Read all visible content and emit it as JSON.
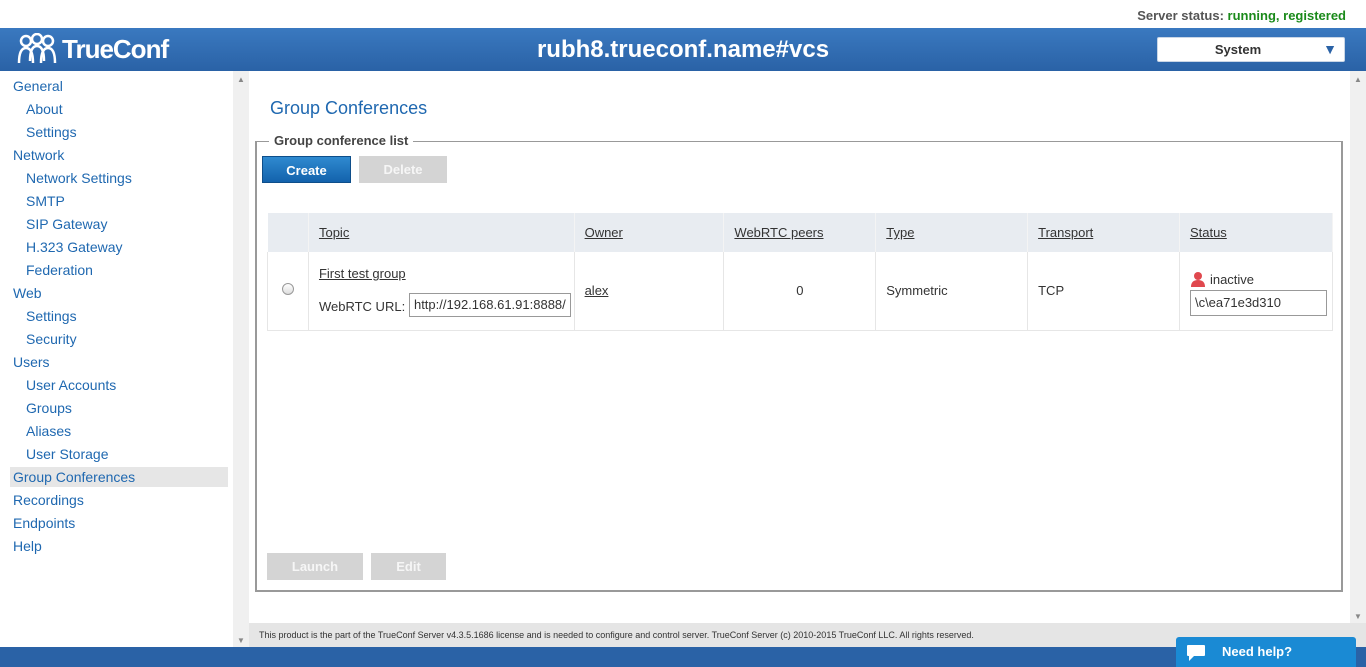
{
  "server_status": {
    "label": "Server status:",
    "value": "running, registered"
  },
  "header": {
    "logo_text": "TrueConf",
    "title": "rubh8.trueconf.name#vcs",
    "select_value": "System"
  },
  "sidebar": {
    "items": [
      {
        "label": "General",
        "level": 0
      },
      {
        "label": "About",
        "level": 1
      },
      {
        "label": "Settings",
        "level": 1
      },
      {
        "label": "Network",
        "level": 0
      },
      {
        "label": "Network Settings",
        "level": 1
      },
      {
        "label": "SMTP",
        "level": 1
      },
      {
        "label": "SIP Gateway",
        "level": 1
      },
      {
        "label": "H.323 Gateway",
        "level": 1
      },
      {
        "label": "Federation",
        "level": 1
      },
      {
        "label": "Web",
        "level": 0
      },
      {
        "label": "Settings",
        "level": 1
      },
      {
        "label": "Security",
        "level": 1
      },
      {
        "label": "Users",
        "level": 0
      },
      {
        "label": "User Accounts",
        "level": 1
      },
      {
        "label": "Groups",
        "level": 1
      },
      {
        "label": "Aliases",
        "level": 1
      },
      {
        "label": "User Storage",
        "level": 1
      },
      {
        "label": "Group Conferences",
        "level": 0,
        "active": true
      },
      {
        "label": "Recordings",
        "level": 0
      },
      {
        "label": "Endpoints",
        "level": 0
      },
      {
        "label": "Help",
        "level": 0
      }
    ]
  },
  "main": {
    "title": "Group Conferences",
    "legend": "Group conference list",
    "buttons": {
      "create": "Create",
      "delete": "Delete",
      "launch": "Launch",
      "edit": "Edit"
    },
    "table": {
      "headers": [
        "Topic",
        "Owner",
        "WebRTC peers",
        "Type",
        "Transport",
        "Status"
      ],
      "rows": [
        {
          "topic": "First test group",
          "webrtc_label": "WebRTC URL:",
          "webrtc_url": "http://192.168.61.91:8888/",
          "owner": "alex",
          "peers": "0",
          "type": "Symmetric",
          "transport": "TCP",
          "status": "inactive",
          "conf_id": "\\c\\ea71e3d310"
        }
      ]
    }
  },
  "footer": {
    "text": "This product is the part of the TrueConf Server v4.3.5.1686 license and is needed to configure and control server. TrueConf Server (c) 2010-2015 TrueConf LLC. All rights reserved."
  },
  "help_widget": {
    "label": "Need help?"
  },
  "colors": {
    "accent": "#2a62a6",
    "link": "#1f68b0",
    "status_ok": "#1a8a1a",
    "inactive_icon": "#e0484e"
  }
}
